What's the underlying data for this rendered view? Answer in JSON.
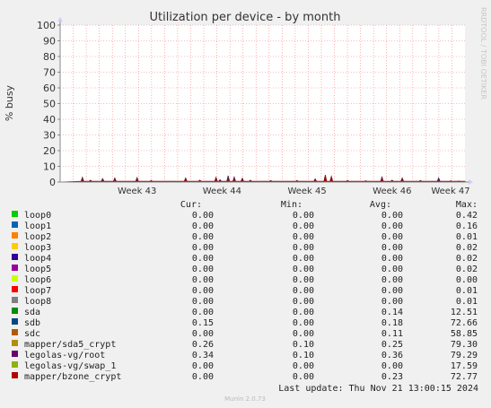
{
  "colors": {
    "background": "#f0f0f0",
    "plot_background": "#ffffff",
    "grid": "#f08080",
    "axis": "#888888",
    "text": "#222222",
    "watermark": "#c8c8c8"
  },
  "chart_data": {
    "type": "area",
    "title": "Utilization per device - by month",
    "ylabel": "% busy",
    "ylim": [
      0,
      100
    ],
    "yticks": [
      0,
      10,
      20,
      30,
      40,
      50,
      60,
      70,
      80,
      90,
      100
    ],
    "xticks": [
      "Week 43",
      "Week 44",
      "Week 45",
      "Week 46",
      "Week 47"
    ],
    "grid": true,
    "watermark": "RRDTOOL / TOBI OETIKER",
    "columns": [
      "Cur:",
      "Min:",
      "Avg:",
      "Max:"
    ],
    "series": [
      {
        "name": "loop0",
        "color": "#00cc00",
        "cur": "0.00",
        "min": "0.00",
        "avg": "0.00",
        "max": "0.42"
      },
      {
        "name": "loop1",
        "color": "#0066b3",
        "cur": "0.00",
        "min": "0.00",
        "avg": "0.00",
        "max": "0.16"
      },
      {
        "name": "loop2",
        "color": "#ff8000",
        "cur": "0.00",
        "min": "0.00",
        "avg": "0.00",
        "max": "0.01"
      },
      {
        "name": "loop3",
        "color": "#ffcc00",
        "cur": "0.00",
        "min": "0.00",
        "avg": "0.00",
        "max": "0.02"
      },
      {
        "name": "loop4",
        "color": "#330099",
        "cur": "0.00",
        "min": "0.00",
        "avg": "0.00",
        "max": "0.02"
      },
      {
        "name": "loop5",
        "color": "#990099",
        "cur": "0.00",
        "min": "0.00",
        "avg": "0.00",
        "max": "0.02"
      },
      {
        "name": "loop6",
        "color": "#ccff00",
        "cur": "0.00",
        "min": "0.00",
        "avg": "0.00",
        "max": "0.00"
      },
      {
        "name": "loop7",
        "color": "#ff0000",
        "cur": "0.00",
        "min": "0.00",
        "avg": "0.00",
        "max": "0.01"
      },
      {
        "name": "loop8",
        "color": "#808080",
        "cur": "0.00",
        "min": "0.00",
        "avg": "0.00",
        "max": "0.01"
      },
      {
        "name": "sda",
        "color": "#008f00",
        "cur": "0.00",
        "min": "0.00",
        "avg": "0.14",
        "max": "12.51"
      },
      {
        "name": "sdb",
        "color": "#00487d",
        "cur": "0.15",
        "min": "0.00",
        "avg": "0.18",
        "max": "72.66"
      },
      {
        "name": "sdc",
        "color": "#b35a00",
        "cur": "0.00",
        "min": "0.00",
        "avg": "0.11",
        "max": "58.85"
      },
      {
        "name": "mapper/sda5_crypt",
        "color": "#b38f00",
        "cur": "0.26",
        "min": "0.10",
        "avg": "0.25",
        "max": "79.30"
      },
      {
        "name": "legolas-vg/root",
        "color": "#6b006b",
        "cur": "0.34",
        "min": "0.10",
        "avg": "0.36",
        "max": "79.29"
      },
      {
        "name": "legolas-vg/swap_1",
        "color": "#8fb300",
        "cur": "0.00",
        "min": "0.00",
        "avg": "0.00",
        "max": "17.59"
      },
      {
        "name": "mapper/bzone_crypt",
        "color": "#b30000",
        "cur": "0.00",
        "min": "0.00",
        "avg": "0.23",
        "max": "72.77"
      }
    ],
    "spikes": [
      {
        "x": 0.055,
        "y": 3.0
      },
      {
        "x": 0.075,
        "y": 1.2
      },
      {
        "x": 0.105,
        "y": 2.2
      },
      {
        "x": 0.135,
        "y": 2.6
      },
      {
        "x": 0.19,
        "y": 2.8
      },
      {
        "x": 0.225,
        "y": 1.0
      },
      {
        "x": 0.31,
        "y": 2.6
      },
      {
        "x": 0.345,
        "y": 1.2
      },
      {
        "x": 0.385,
        "y": 3.0
      },
      {
        "x": 0.395,
        "y": 1.5
      },
      {
        "x": 0.415,
        "y": 4.0
      },
      {
        "x": 0.43,
        "y": 3.2
      },
      {
        "x": 0.45,
        "y": 2.4
      },
      {
        "x": 0.47,
        "y": 1.2
      },
      {
        "x": 0.52,
        "y": 1.0
      },
      {
        "x": 0.585,
        "y": 1.0
      },
      {
        "x": 0.63,
        "y": 2.0
      },
      {
        "x": 0.655,
        "y": 4.5
      },
      {
        "x": 0.67,
        "y": 3.6
      },
      {
        "x": 0.71,
        "y": 1.0
      },
      {
        "x": 0.755,
        "y": 0.8
      },
      {
        "x": 0.795,
        "y": 3.2
      },
      {
        "x": 0.82,
        "y": 1.2
      },
      {
        "x": 0.845,
        "y": 2.6
      },
      {
        "x": 0.89,
        "y": 1.0
      },
      {
        "x": 0.935,
        "y": 2.6
      },
      {
        "x": 0.965,
        "y": 0.8
      },
      {
        "x": 0.985,
        "y": 0.6
      }
    ]
  },
  "footer": {
    "last_update": "Last update: Thu Nov 21 13:00:15 2024",
    "version": "Munin 2.0.73"
  }
}
